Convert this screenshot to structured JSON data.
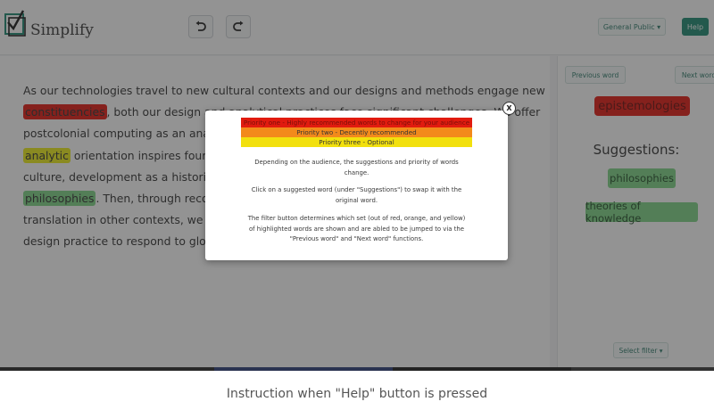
{
  "header": {
    "brand": "Simplify",
    "undo_icon": "undo-icon",
    "redo_icon": "redo-icon",
    "audience_label": "General Public ▾",
    "help_label": "Help"
  },
  "editor": {
    "lines": [
      [
        "As our technologies travel to new cultural contexts and our designs and methods engage new"
      ],
      [
        "constituencies",
        ", both our design and analytical practices face significant challenges. We offer"
      ],
      [
        "postcolonial computing as an analytical orientation",
        ""
      ],
      [
        "analytic",
        " orientation inspires four key"
      ],
      [
        "culture, development as a historical p"
      ],
      [
        "philosophies",
        ". Then, through reconsid"
      ],
      [
        "translation in other contexts, we offe"
      ],
      [
        "design practice to respond to global c"
      ]
    ]
  },
  "side": {
    "prev_label": "Previous word",
    "next_label": "Next word",
    "current_word": "epistemologies",
    "suggestions_title": "Suggestions:",
    "suggestions": [
      "philosophies",
      "theories of knowledge"
    ],
    "filter_label": "Select filter ▾"
  },
  "modal": {
    "close_label": "X",
    "priorities": [
      "Priority one - Highly recommended words to change for your audience",
      "Priority two - Decently recommended",
      "Priority three - Optional"
    ],
    "info": [
      [
        "Depending on the audience, the suggestions and priority of words",
        "change."
      ],
      [
        "Click on a suggested word (under \"Suggestions\") to swap it with the",
        "original word."
      ],
      [
        "The filter button determines which set (out of red, orange, and yellow)",
        "of highlighted words are shown and are abled to be jumped to via the",
        "\"Previous word\" and \"Next word\" functions."
      ]
    ]
  },
  "caption": "Instruction when \"Help\" button is pressed",
  "colors": {
    "accent": "#1f8a72",
    "priority_red": "#e11b0f",
    "priority_orange": "#f38a1b",
    "priority_yellow": "#f2e00e",
    "suggestion_green": "#7ed486"
  }
}
